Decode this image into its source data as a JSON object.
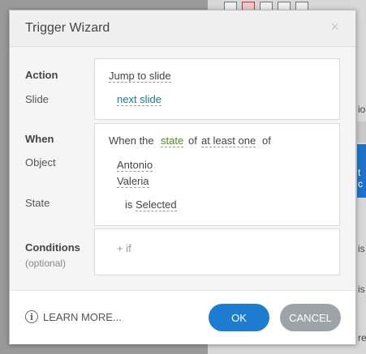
{
  "dialog": {
    "title": "Trigger Wizard",
    "close_glyph": "×"
  },
  "action": {
    "label": "Action",
    "value": "Jump to slide",
    "slide_label": "Slide",
    "slide_value": "next slide"
  },
  "when": {
    "label": "When",
    "prefix": "When the",
    "state_link": "state",
    "of_word": "of",
    "quantifier_link": "at least one",
    "suffix": "of",
    "object_label": "Object",
    "objects": [
      "Antonio",
      "Valeria"
    ],
    "state_label": "State",
    "state_is": "is",
    "state_value": "Selected"
  },
  "conditions": {
    "label": "Conditions",
    "sublabel": "(optional)",
    "add_if": "+ if"
  },
  "footer": {
    "learn_more": "LEARN MORE...",
    "ok": "OK",
    "cancel": "CANCEL"
  },
  "background": {
    "fragments": [
      "io",
      "t c",
      "is",
      "is",
      "re"
    ]
  },
  "colors": {
    "ok_button": "#1e7cd0",
    "cancel_button": "#9ea3a8",
    "link_teal": "#1a7a8a",
    "link_green": "#4a8a1a"
  }
}
